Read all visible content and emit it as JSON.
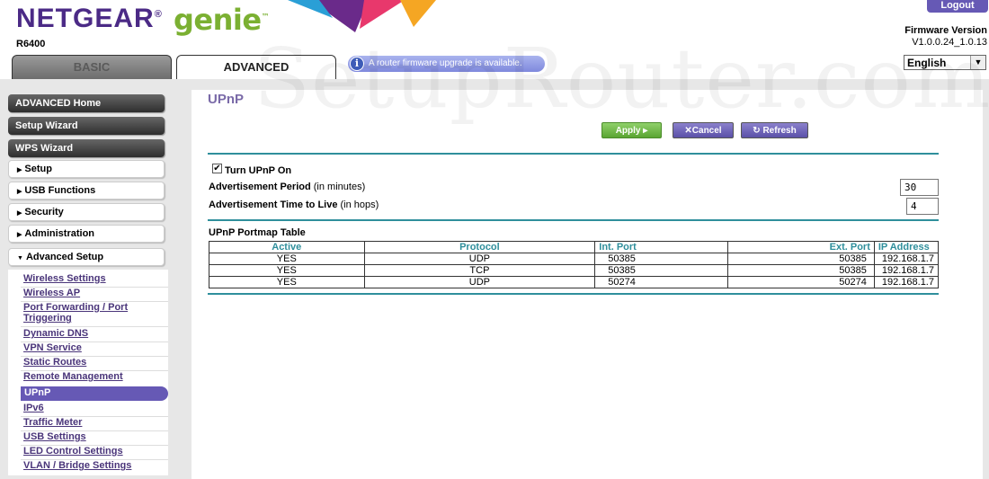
{
  "header": {
    "brand": "NETGEAR",
    "brand_mark": "®",
    "product": "genie",
    "product_mark": "™",
    "model": "R6400",
    "logout_label": "Logout",
    "firmware_label": "Firmware Version",
    "firmware_value": "V1.0.0.24_1.0.13",
    "language": "English",
    "tabs": [
      {
        "label": "BASIC"
      },
      {
        "label": "ADVANCED"
      }
    ],
    "notice": "A router firmware upgrade is available.",
    "watermark": "SetupRouter.com"
  },
  "sidebar": {
    "main_buttons": [
      {
        "label": "ADVANCED Home"
      },
      {
        "label": "Setup Wizard"
      },
      {
        "label": "WPS Wizard"
      }
    ],
    "sections": [
      {
        "label": "Setup"
      },
      {
        "label": "USB Functions"
      },
      {
        "label": "Security"
      },
      {
        "label": "Administration"
      },
      {
        "label": "Advanced Setup"
      }
    ],
    "sub_items": [
      {
        "label": "Wireless Settings"
      },
      {
        "label": "Wireless AP"
      },
      {
        "label": "Port Forwarding / Port"
      },
      {
        "label": "Triggering"
      },
      {
        "label": "Dynamic DNS"
      },
      {
        "label": "VPN Service"
      },
      {
        "label": "Static Routes"
      },
      {
        "label": "Remote Management"
      },
      {
        "label": "UPnP"
      },
      {
        "label": "IPv6"
      },
      {
        "label": "Traffic Meter"
      },
      {
        "label": "USB Settings"
      },
      {
        "label": "LED Control Settings"
      },
      {
        "label": "VLAN / Bridge Settings"
      }
    ]
  },
  "main": {
    "title": "UPnP",
    "buttons": {
      "apply": "Apply ▸",
      "cancel": "✕Cancel",
      "refresh": "↻ Refresh"
    },
    "turn_on_label": "Turn UPnP On",
    "turn_on_checked": true,
    "adv_period_label": "Advertisement Period",
    "adv_period_unit": "(in minutes)",
    "adv_period_value": "30",
    "adv_ttl_label": "Advertisement Time to Live",
    "adv_ttl_unit": "(in hops)",
    "adv_ttl_value": "4",
    "table_title": "UPnP Portmap Table",
    "columns": [
      "Active",
      "Protocol",
      "Int. Port",
      "Ext. Port",
      "IP Address"
    ],
    "rows": [
      [
        "YES",
        "UDP",
        "50385",
        "50385",
        "192.168.1.7"
      ],
      [
        "YES",
        "TCP",
        "50385",
        "50385",
        "192.168.1.7"
      ],
      [
        "YES",
        "UDP",
        "50274",
        "50274",
        "192.168.1.7"
      ]
    ]
  },
  "colors": {
    "brand_purple": "#4b2a86",
    "genie_green": "#7bb032",
    "accent_teal": "#2f8f9c",
    "selected_purple": "#6659b5"
  }
}
